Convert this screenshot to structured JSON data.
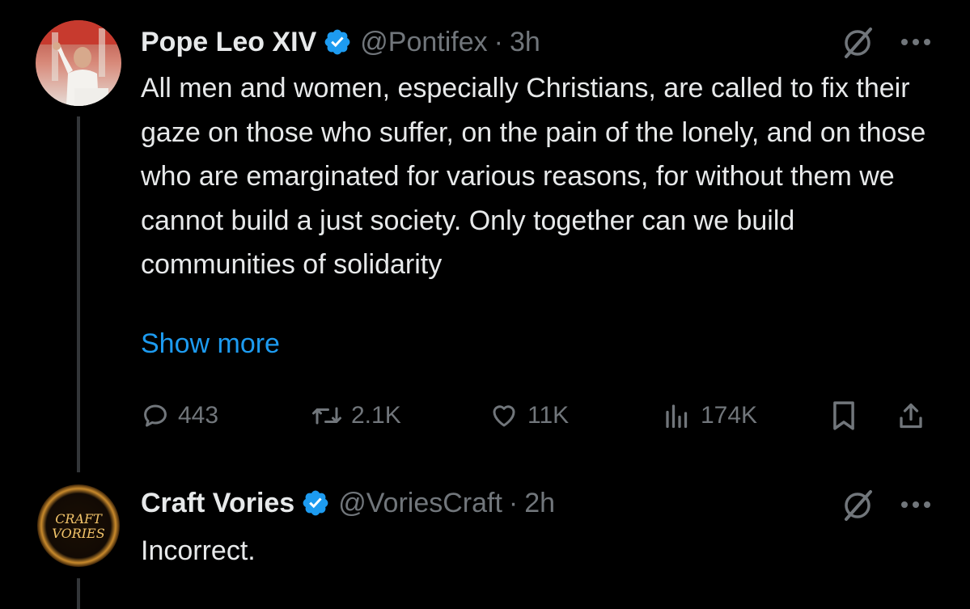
{
  "tweets": [
    {
      "author": "Pope Leo XIV",
      "handle": "@Pontifex",
      "separator": "·",
      "time": "3h",
      "text": "All men and women, especially Christians, are called to fix their gaze on those who suffer, on the pain of the lonely, and on those who are emarginated for various reasons, for without them we cannot build a just society. Only together can we build communities of solidarity",
      "show_more": "Show more",
      "stats": {
        "replies": "443",
        "reposts": "2.1K",
        "likes": "11K",
        "views": "174K"
      }
    },
    {
      "author": "Craft Vories",
      "handle": "@VoriesCraft",
      "separator": "·",
      "time": "2h",
      "text": "Incorrect.",
      "avatar_logo_text": "CRAFT VORIES"
    }
  ],
  "icons": {
    "verified": "verified-badge-icon",
    "grok": "grok-icon",
    "more": "more-dots-icon",
    "reply": "reply-icon",
    "repost": "repost-icon",
    "like": "heart-icon",
    "views": "views-icon",
    "bookmark": "bookmark-icon",
    "share": "share-icon"
  },
  "colors": {
    "background": "#000000",
    "text": "#e7e9ea",
    "muted": "#71767b",
    "link": "#1d9bf0",
    "verified": "#1d9bf0"
  }
}
